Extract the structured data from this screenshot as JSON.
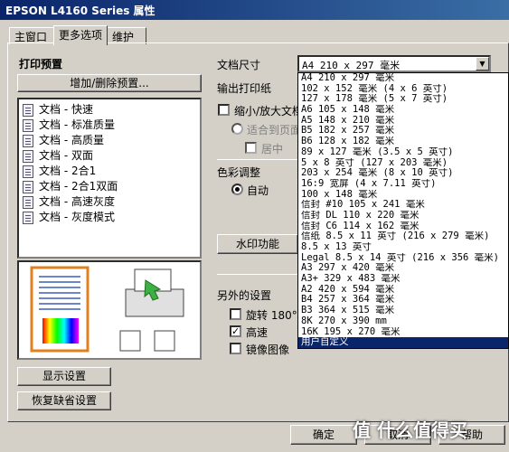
{
  "window": {
    "title": "EPSON L4160 Series 属性"
  },
  "tabs": [
    "主窗口",
    "更多选项",
    "维护"
  ],
  "presets": {
    "heading": "打印预置",
    "add_remove_button": "增加/删除预置...",
    "items": [
      "文档 - 快速",
      "文档 - 标准质量",
      "文档 - 高质量",
      "文档 - 双面",
      "文档 - 2合1",
      "文档 - 2合1双面",
      "文档 - 高速灰度",
      "文档 - 灰度模式"
    ]
  },
  "buttons": {
    "show_settings": "显示设置",
    "restore_defaults": "恢复缺省设置",
    "ok": "确定",
    "cancel": "取消",
    "help": "帮助"
  },
  "settings": {
    "doc_size_label": "文档尺寸",
    "output_paper_label": "输出打印纸",
    "reduce_enlarge_label": "缩小/放大文档",
    "fit_page_label": "适合到页面",
    "center_label": "居中",
    "color_adjust_label": "色彩调整",
    "auto_label": "自动",
    "watermark_button": "水印功能",
    "extra_settings_label": "另外的设置",
    "rotate_label": "旋转 180°",
    "high_speed_label": "高速",
    "mirror_label": "镜像图像",
    "high_speed_checked": true
  },
  "doc_size_combo": {
    "selected": "A4 210 x 297 毫米",
    "options": [
      "A4 210 x 297 毫米",
      "102 x 152 毫米 (4 x 6 英寸)",
      "127 x 178 毫米 (5 x 7 英寸)",
      "A6 105 x 148 毫米",
      "A5 148 x 210 毫米",
      "B5 182 x 257 毫米",
      "B6 128 x 182 毫米",
      "89 x 127 毫米 (3.5 x 5 英寸)",
      "5 x 8 英寸 (127 x 203 毫米)",
      "203 x 254 毫米 (8 x 10 英寸)",
      "16:9 宽屏 (4 x 7.11 英寸)",
      "100 x 148 毫米",
      "信封 #10 105 x 241 毫米",
      "信封 DL 110 x 220 毫米",
      "信封 C6 114 x 162 毫米",
      "信纸 8.5 x 11 英寸 (216 x 279 毫米)",
      "8.5 x 13 英寸",
      "Legal 8.5 x 14 英寸 (216 x 356 毫米)",
      "A3 297 x 420 毫米",
      "A3+ 329 x 483 毫米",
      "A2 420 x 594 毫米",
      "B4 257 x 364 毫米",
      "B3 364 x 515 毫米",
      "8K 270 x 390 mm",
      "16K 195 x 270 毫米",
      "用户自定义"
    ],
    "highlighted": "用户自定义"
  },
  "watermark_text": "值 什么值得买"
}
